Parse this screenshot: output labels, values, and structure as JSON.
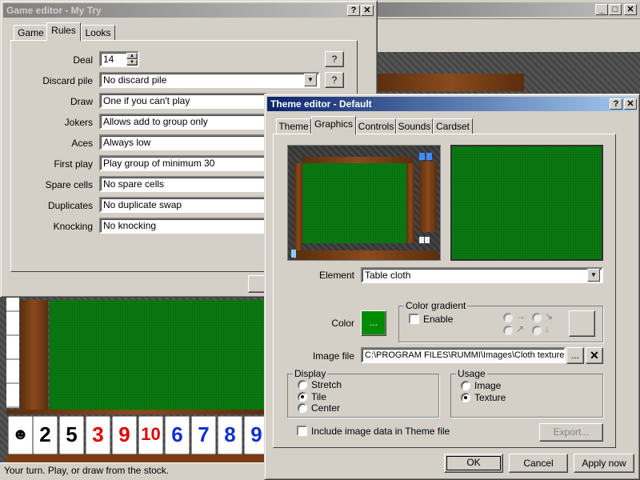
{
  "background_window": {
    "controls": [
      "_",
      "□",
      "✕"
    ]
  },
  "game_editor": {
    "title": "Game editor - My Try",
    "tabs": [
      "Game",
      "Rules",
      "Looks"
    ],
    "rules": [
      {
        "label": "Deal",
        "value": "14"
      },
      {
        "label": "Discard pile",
        "value": "No discard pile"
      },
      {
        "label": "Draw",
        "value": "One if you can't play"
      },
      {
        "label": "Jokers",
        "value": "Allows add to group only"
      },
      {
        "label": "Aces",
        "value": "Always low"
      },
      {
        "label": "First play",
        "value": "Play group of minimum 30"
      },
      {
        "label": "Spare cells",
        "value": "No spare cells"
      },
      {
        "label": "Duplicates",
        "value": "No duplicate swap"
      },
      {
        "label": "Knocking",
        "value": "No knocking"
      }
    ],
    "help_label": "?"
  },
  "theme_editor": {
    "title": "Theme editor - Default",
    "tabs": [
      "Theme",
      "Graphics",
      "Controls",
      "Sounds",
      "Cardset"
    ],
    "element_label": "Element",
    "element_value": "Table cloth",
    "color_label": "Color",
    "color_swatch_label": "...",
    "color_value": "#008c00",
    "gradient": {
      "title": "Color gradient",
      "enable_label": "Enable",
      "arrows": [
        "→",
        "↘",
        "↗",
        "↓"
      ]
    },
    "image_file_label": "Image file",
    "image_file_value": "C:\\PROGRAM FILES\\RUMMI\\Images\\Cloth texture.",
    "browse_label": "...",
    "clear_label": "✕",
    "display": {
      "title": "Display",
      "options": [
        "Stretch",
        "Tile",
        "Center"
      ],
      "selected": "Tile"
    },
    "usage": {
      "title": "Usage",
      "options": [
        "Image",
        "Texture"
      ],
      "selected": "Texture"
    },
    "include_label": "Include image data in Theme file",
    "export_label": "Export...",
    "ok_label": "OK",
    "cancel_label": "Cancel",
    "apply_label": "Apply now"
  },
  "game_board": {
    "tiles": [
      {
        "value": "2",
        "color": "#000000"
      },
      {
        "value": "5",
        "color": "#000000"
      },
      {
        "value": "3",
        "color": "#e00000"
      },
      {
        "value": "9",
        "color": "#e00000"
      },
      {
        "value": "10",
        "color": "#e00000"
      },
      {
        "value": "6",
        "color": "#1030d0"
      },
      {
        "value": "7",
        "color": "#1030d0"
      },
      {
        "value": "8",
        "color": "#1030d0"
      },
      {
        "value": "9",
        "color": "#1030d0"
      }
    ],
    "status_text": "Your turn. Play, or draw from the stock."
  }
}
